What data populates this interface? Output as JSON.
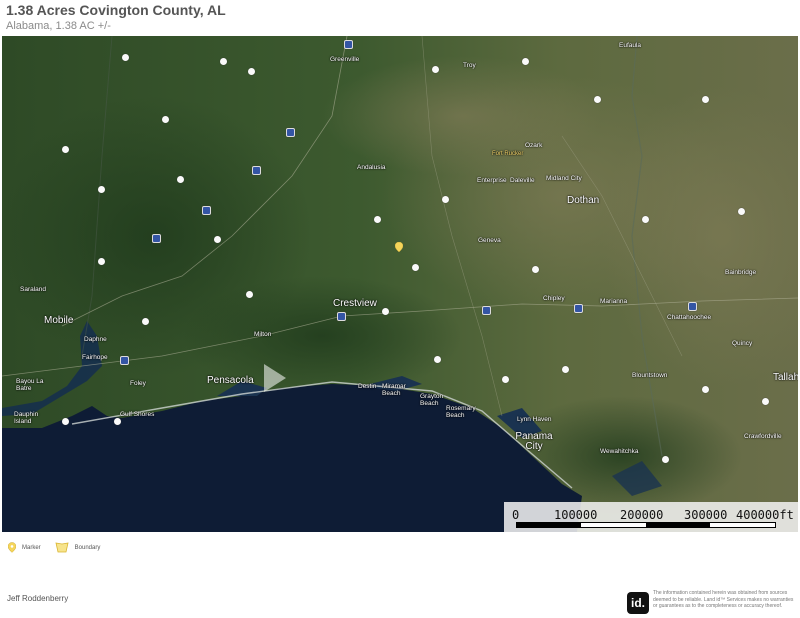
{
  "header": {
    "title": "1.38 Acres Covington County, AL",
    "subtitle": "Alabama, 1.38 AC +/-"
  },
  "map": {
    "cities": [
      {
        "name": "Mobile",
        "size": "big"
      },
      {
        "name": "Pensacola",
        "size": "big"
      },
      {
        "name": "Crestview",
        "size": "big"
      },
      {
        "name": "Dothan",
        "size": "big"
      },
      {
        "name": "Panama City",
        "size": "big"
      },
      {
        "name": "Destin",
        "size": "small"
      },
      {
        "name": "Andalusia",
        "size": "small"
      },
      {
        "name": "Enterprise",
        "size": "small"
      },
      {
        "name": "Daleville",
        "size": "small"
      },
      {
        "name": "Geneva",
        "size": "small"
      },
      {
        "name": "Chipley",
        "size": "small"
      },
      {
        "name": "Marianna",
        "size": "small"
      },
      {
        "name": "Bainbridge",
        "size": "small"
      },
      {
        "name": "Chattahoochee",
        "size": "small"
      },
      {
        "name": "Quincy",
        "size": "small"
      },
      {
        "name": "Blountstown",
        "size": "small"
      },
      {
        "name": "Wewahitchka",
        "size": "small"
      },
      {
        "name": "Crawfordville",
        "size": "small"
      },
      {
        "name": "Eufaula",
        "size": "small"
      },
      {
        "name": "Ozark",
        "size": "small"
      },
      {
        "name": "Midland City",
        "size": "small"
      },
      {
        "name": "Milton",
        "size": "small"
      },
      {
        "name": "Foley",
        "size": "small"
      },
      {
        "name": "Gulf Shores",
        "size": "small"
      },
      {
        "name": "Daphne",
        "size": "small"
      },
      {
        "name": "Fairhope",
        "size": "small"
      },
      {
        "name": "Saraland",
        "size": "small"
      },
      {
        "name": "Bayou La Batre",
        "size": "small"
      },
      {
        "name": "Dauphin Island",
        "size": "small"
      },
      {
        "name": "Miramar Beach",
        "size": "small"
      },
      {
        "name": "Grayton Beach",
        "size": "small"
      },
      {
        "name": "Rosemary Beach",
        "size": "small"
      },
      {
        "name": "Lynn Haven",
        "size": "small"
      },
      {
        "name": "Greenville",
        "size": "small"
      },
      {
        "name": "Troy",
        "size": "small"
      },
      {
        "name": "Tallahassee",
        "size": "big"
      },
      {
        "name": "Fort Rucker",
        "size": "gold"
      }
    ],
    "scale": {
      "labels": [
        "0",
        "100000",
        "200000",
        "300000",
        "400000ft"
      ]
    },
    "marker": {
      "color": "#f5d55a"
    }
  },
  "legend": {
    "marker_label": "Marker",
    "boundary_label": "Boundary"
  },
  "footer": {
    "agent_name": "Jeff Roddenberry",
    "logo_text": "id.",
    "disclaimer": "The information contained herein was obtained from sources deemed to be reliable. Land id™ Services makes no warranties or guarantees as to the completeness or accuracy thereof."
  }
}
